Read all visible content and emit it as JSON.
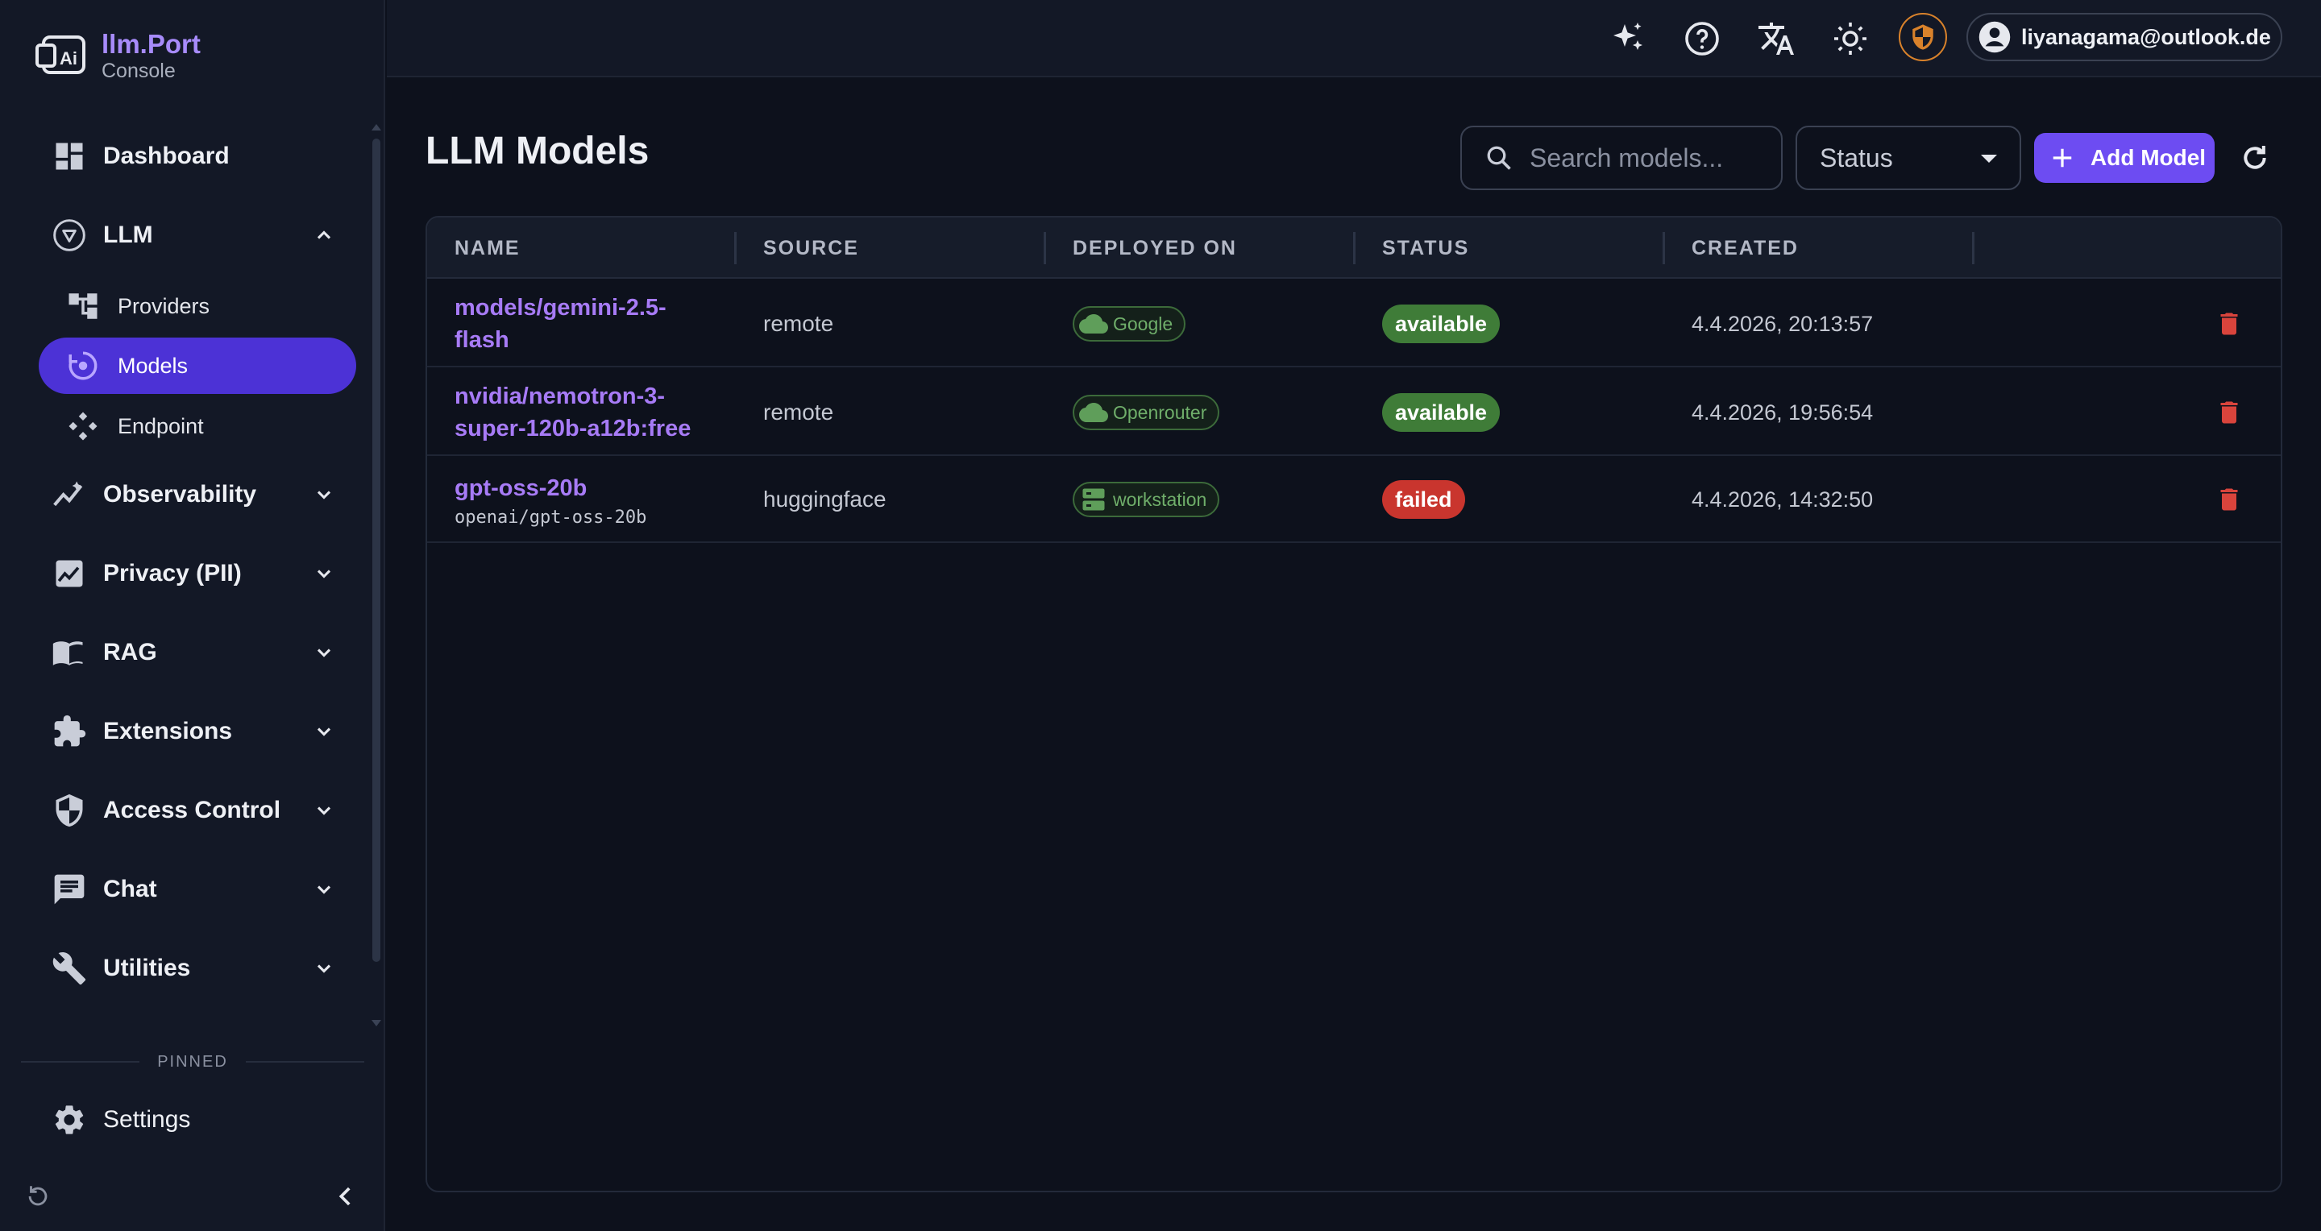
{
  "brand": {
    "name": "llm.Port",
    "subtitle": "Console"
  },
  "sidebar": {
    "items": [
      {
        "label": "Dashboard",
        "icon": "dashboard-icon"
      },
      {
        "label": "LLM",
        "icon": "llm-icon",
        "expanded": true,
        "children": [
          {
            "label": "Providers",
            "icon": "providers-icon"
          },
          {
            "label": "Models",
            "icon": "models-icon",
            "active": true
          },
          {
            "label": "Endpoint",
            "icon": "endpoint-icon"
          }
        ]
      },
      {
        "label": "Observability",
        "icon": "observability-icon"
      },
      {
        "label": "Privacy (PII)",
        "icon": "privacy-icon"
      },
      {
        "label": "RAG",
        "icon": "book-icon"
      },
      {
        "label": "Extensions",
        "icon": "puzzle-icon"
      },
      {
        "label": "Access Control",
        "icon": "shield-icon"
      },
      {
        "label": "Chat",
        "icon": "chat-icon"
      },
      {
        "label": "Utilities",
        "icon": "wrench-icon"
      }
    ],
    "pinned_label": "PINNED",
    "pinned_items": [
      {
        "label": "Settings",
        "icon": "gear-icon"
      }
    ]
  },
  "topbar": {
    "user_email": "liyanagama@outlook.de"
  },
  "page": {
    "title": "LLM Models",
    "search_placeholder": "Search models...",
    "status_filter": "Status",
    "add_button": "Add Model"
  },
  "table": {
    "columns": [
      "NAME",
      "SOURCE",
      "DEPLOYED ON",
      "STATUS",
      "CREATED"
    ],
    "rows": [
      {
        "name_line1": "models/gemini-2.5-",
        "name_line2": "flash",
        "subname": "",
        "source": "remote",
        "deployed_on": "Google",
        "deployed_icon": "cloud-icon",
        "status": "available",
        "created": "4.4.2026, 20:13:57"
      },
      {
        "name_line1": "nvidia/nemotron-3-",
        "name_line2": "super-120b-a12b:free",
        "subname": "",
        "source": "remote",
        "deployed_on": "Openrouter",
        "deployed_icon": "cloud-icon",
        "status": "available",
        "created": "4.4.2026, 19:56:54"
      },
      {
        "name_line1": "gpt-oss-20b",
        "name_line2": "",
        "subname": "openai/gpt-oss-20b",
        "source": "huggingface",
        "deployed_on": "workstation",
        "deployed_icon": "server-icon",
        "status": "failed",
        "created": "4.4.2026, 14:32:50"
      }
    ]
  },
  "colors": {
    "accent": "#6d4cf2",
    "link": "#a77bf6",
    "available": "#3f7c38",
    "failed": "#c9352e",
    "delete": "#d9443c",
    "security": "#d9822b"
  }
}
